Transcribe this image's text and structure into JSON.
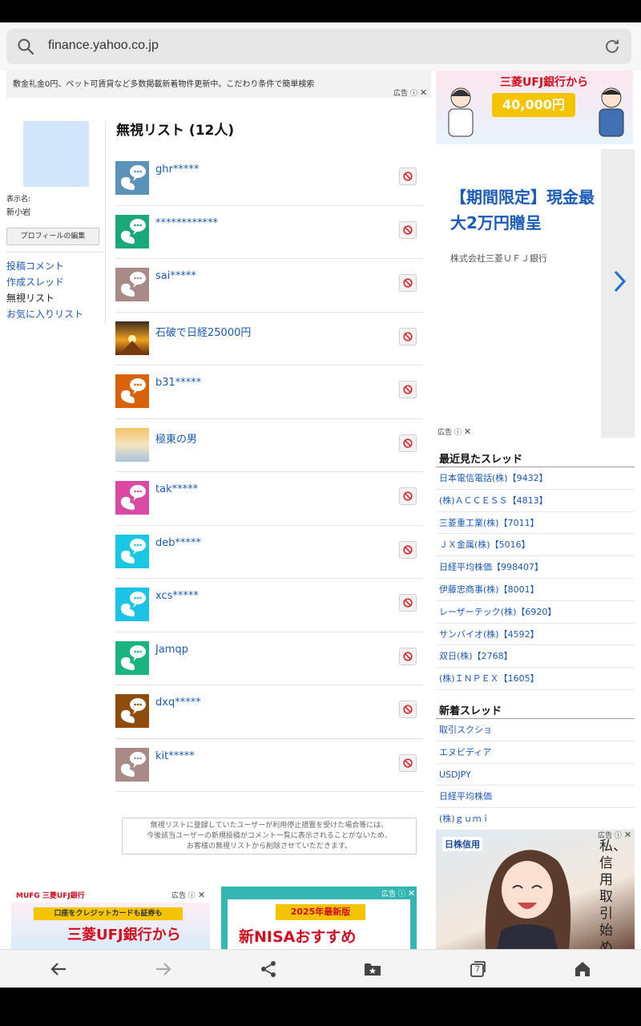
{
  "browser": {
    "url": "finance.yahoo.co.jp",
    "tab_count": "7"
  },
  "top_ad": {
    "text": "敷金礼金0円、ペット可賃貸など多数掲載新着物件更新中。こだわり条件で簡単検索",
    "label": "広告"
  },
  "profile": {
    "display_label": "表示名:",
    "display_name": "新小岩",
    "edit_button": "プロフィールの編集",
    "nav": [
      "投稿コメント",
      "作成スレッド",
      "無視リスト",
      "お気に入りリスト"
    ]
  },
  "ignore_list": {
    "title": "無視リスト (12人)",
    "users": [
      {
        "name": "ghr*****",
        "color": "#5b93b8",
        "kind": "bubble"
      },
      {
        "name": "************",
        "color": "#1aa87a",
        "kind": "bubble"
      },
      {
        "name": "sai*****",
        "color": "#a88a86",
        "kind": "bubble"
      },
      {
        "name": "石破で日経25000円",
        "color": "#d06a10",
        "kind": "photo-sunset"
      },
      {
        "name": "b31*****",
        "color": "#d9620c",
        "kind": "bubble"
      },
      {
        "name": "極東の男",
        "color": "#e9c889",
        "kind": "photo-sky"
      },
      {
        "name": "tak*****",
        "color": "#d94aa3",
        "kind": "bubble"
      },
      {
        "name": "deb*****",
        "color": "#19c7e3",
        "kind": "bubble"
      },
      {
        "name": "xcs*****",
        "color": "#1bc3e6",
        "kind": "bubble"
      },
      {
        "name": "Jamqp",
        "color": "#1ab57e",
        "kind": "bubble"
      },
      {
        "name": "dxq*****",
        "color": "#8f4c0c",
        "kind": "bubble"
      },
      {
        "name": "kit*****",
        "color": "#a88a86",
        "kind": "bubble"
      }
    ],
    "notice": [
      "無視リストに登録していたユーザーが利用停止措置を受けた場合等には、",
      "今後該当ユーザーの新規投稿がコメント一覧に表示されることがないため、",
      "お客様の無視リストから削除させていただきます。"
    ]
  },
  "banner_ad": {
    "headline": "三菱UFJ銀行から",
    "amount": "40,000円"
  },
  "side_ad": {
    "title": "【期間限定】現金最大2万円贈呈",
    "company": "株式会社三菱ＵＦＪ銀行",
    "label": "広告"
  },
  "recent_threads": {
    "title": "最近見たスレッド",
    "items": [
      "日本電信電話(株)【9432】",
      "(株)ＡＣＣＥＳＳ【4813】",
      "三菱重工業(株)【7011】",
      "ＪＸ金属(株)【5016】",
      "日経平均株価【998407】",
      "伊藤忠商事(株)【8001】",
      "レーザーテック(株)【6920】",
      "サンバイオ(株)【4592】",
      "双日(株)【2768】",
      "(株)ＩＮＰＥＸ【1605】"
    ]
  },
  "new_threads": {
    "title": "新着スレッド",
    "items": [
      "取引スクショ",
      "エヌビディア",
      "USDJPY",
      "日経平均株価",
      "(株)ｇｕｍｉ"
    ]
  },
  "bottom_ads": {
    "ad1_brand": "MUFG 三菱UFJ銀行",
    "ad1_line": "口座をクレジットカードも証券も",
    "ad1_main": "三菱UFJ銀行から",
    "ad2_tag": "2025年最新版",
    "ad2_main": "新NISAおすすめ",
    "label": "広告"
  },
  "illust_ad": {
    "brand": "日株信用",
    "text": "私、信用取引始めます",
    "label": "広告"
  }
}
